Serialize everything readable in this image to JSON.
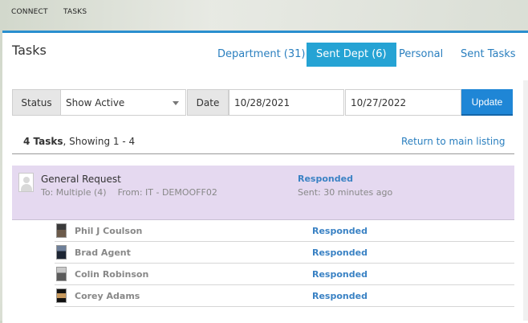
{
  "top_nav": {
    "items": [
      {
        "label": "CONNECT"
      },
      {
        "label": "TASKS"
      }
    ]
  },
  "page": {
    "title": "Tasks"
  },
  "tabs": [
    {
      "label": "Department (31)",
      "active": false
    },
    {
      "label": "Sent Dept (6)",
      "active": true
    },
    {
      "label": "Personal",
      "active": false
    },
    {
      "label": "Sent Tasks",
      "active": false
    }
  ],
  "filters": {
    "status_label": "Status",
    "status_value": "Show Active",
    "date_label": "Date",
    "date_from": "10/28/2021",
    "date_to": "10/27/2022",
    "update_label": "Update"
  },
  "summary": {
    "count_bold": "4 Tasks",
    "showing_text": ", Showing 1 - 4",
    "return_link": "Return to main listing"
  },
  "task": {
    "title": "General Request",
    "to_text": "To: Multiple (4)",
    "from_text": "From: IT - DEMOOFF02",
    "status": "Responded",
    "sent": "Sent: 30 minutes ago"
  },
  "recipients": [
    {
      "name": "Phil J Coulson",
      "status": "Responded"
    },
    {
      "name": "Brad Agent",
      "status": "Responded"
    },
    {
      "name": "Colin Robinson",
      "status": "Responded"
    },
    {
      "name": "Corey Adams",
      "status": "Responded"
    }
  ],
  "colors": {
    "accent": "#25a3d4",
    "link": "#2a7fbf",
    "update_button": "#1f86d6",
    "task_highlight": "#e5d9f0",
    "status_text": "#3a82c4"
  },
  "icons": {
    "status_dropdown": "chevron-down-icon",
    "task_avatar": "person-placeholder-icon"
  }
}
